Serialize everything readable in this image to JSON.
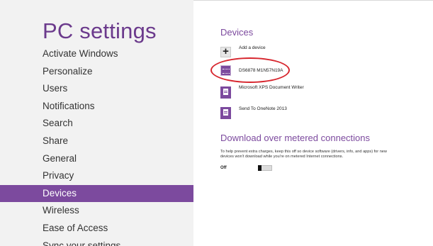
{
  "nav": {
    "title": "PC settings",
    "items": [
      {
        "label": "Activate Windows"
      },
      {
        "label": "Personalize"
      },
      {
        "label": "Users"
      },
      {
        "label": "Notifications"
      },
      {
        "label": "Search"
      },
      {
        "label": "Share"
      },
      {
        "label": "General"
      },
      {
        "label": "Privacy"
      },
      {
        "label": "Devices",
        "selected": true
      },
      {
        "label": "Wireless"
      },
      {
        "label": "Ease of Access"
      },
      {
        "label": "Sync your settings"
      }
    ]
  },
  "devices": {
    "title": "Devices",
    "add_label": "Add a device",
    "list": [
      {
        "label": "DS6878 M1N57N19A",
        "icon": "keyboard-icon"
      },
      {
        "label": "Microsoft XPS Document Writer",
        "icon": "printer-icon"
      },
      {
        "label": "Send To OneNote 2013",
        "icon": "printer-icon"
      }
    ]
  },
  "metered": {
    "title": "Download over metered connections",
    "description": "To help prevent extra charges, keep this off so device software (drivers, info, and apps) for new devices won't download while you're on metered Internet connections.",
    "toggle_label": "Off",
    "toggle_on": false
  },
  "colors": {
    "accent": "#7c4a9e",
    "highlight": "#d7262e"
  }
}
